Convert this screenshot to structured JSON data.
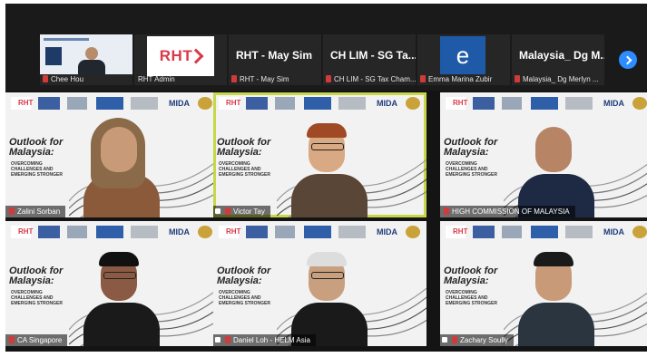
{
  "strip": {
    "participants": [
      {
        "caption": "Chee Hou"
      },
      {
        "caption": "RHT Admin",
        "logo": "RHT"
      },
      {
        "name": "RHT - May Sim",
        "caption": "RHT - May Sim"
      },
      {
        "name": "CH LIM - SG Ta...",
        "caption": "CH LIM - SG Tax Cham..."
      },
      {
        "avatar_letter": "e",
        "caption": "Emma Marina Zubir"
      },
      {
        "name": "Malaysia_ Dg M...",
        "caption": "Malaysia_ Dg Merlyn ..."
      }
    ],
    "next_icon": "chevron-right-icon"
  },
  "slide": {
    "title": "Outlook for Malaysia:",
    "subtitle": "OVERCOMING CHALLENGES AND EMERGING STRONGER",
    "logo_rht": "RHT",
    "logo_mida": "MIDA"
  },
  "gallery": [
    {
      "name": "Zalini Sorban"
    },
    {
      "name": "Victor Tay"
    },
    {
      "name": "HIGH COMMISSION OF MALAYSIA"
    },
    {
      "name": "CA Singapore"
    },
    {
      "name": "Daniel Loh - HELM Asia"
    },
    {
      "name": "Zachary Soully"
    }
  ],
  "colors": {
    "active_border": "#c8d64a",
    "mic_muted": "#d23a3a",
    "next": "#2d8cff",
    "rht_red": "#d83a4a"
  }
}
